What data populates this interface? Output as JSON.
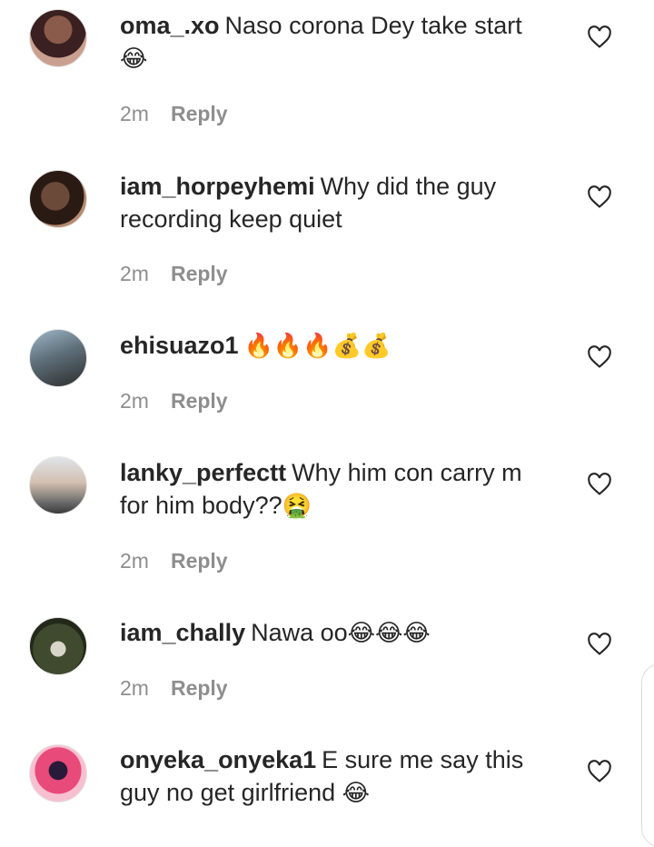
{
  "comments": [
    {
      "username": "oma_.xo",
      "text": "Naso corona Dey take start",
      "emoji": "😂",
      "time": "2m",
      "reply": "Reply"
    },
    {
      "username": "iam_horpeyhemi",
      "text": "Why did the guy recording keep quiet",
      "emoji": "",
      "time": "2m",
      "reply": "Reply"
    },
    {
      "username": "ehisuazo1",
      "text": "",
      "emoji": "🔥🔥🔥💰💰",
      "time": "2m",
      "reply": "Reply"
    },
    {
      "username": "lanky_perfectt",
      "text": "Why him con carry m for him body??",
      "emoji": "🤮",
      "time": "2m",
      "reply": "Reply"
    },
    {
      "username": "iam_chally",
      "text": "Nawa oo",
      "emoji": "😂😂😂",
      "time": "2m",
      "reply": "Reply"
    },
    {
      "username": "onyeka_onyeka1",
      "text": "E sure me say this guy no get girlfriend",
      "emoji": "😂",
      "time": "",
      "reply": ""
    }
  ],
  "icons": {
    "like": "heart-outline-icon",
    "avatar": "user-avatar"
  }
}
